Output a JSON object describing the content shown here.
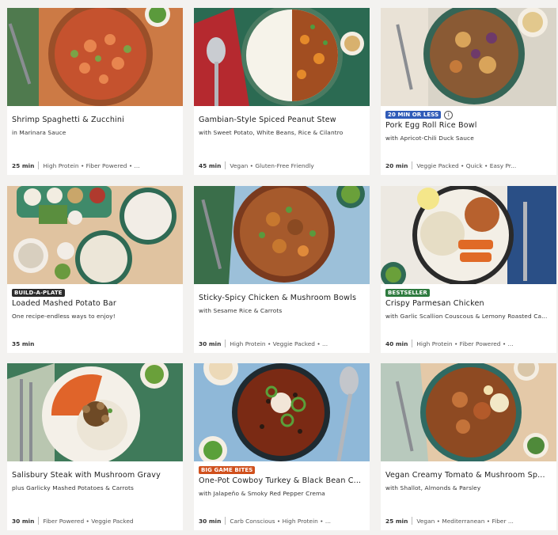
{
  "colors": {
    "badge_blue": "#2f5bb8",
    "badge_dark": "#2b2b2b",
    "badge_green": "#2d7a3e",
    "badge_orange": "#d0501c"
  },
  "cards": [
    {
      "badge": "",
      "title": "Shrimp Spaghetti & Zucchini",
      "subtitle": "in Marinara Sauce",
      "time": "25 min",
      "tags": "High Protein • Fiber Powered • ..."
    },
    {
      "badge": "",
      "title": "Gambian-Style Spiced Peanut Stew",
      "subtitle": "with Sweet Potato, White Beans, Rice & Cilantro",
      "time": "45 min",
      "tags": "Vegan • Gluten-Free Friendly"
    },
    {
      "badge": "20 MIN OR LESS",
      "title": "Pork Egg Roll Rice Bowl",
      "subtitle": "with Apricot-Chili Duck Sauce",
      "time": "20 min",
      "tags": "Veggie Packed • Quick • Easy Pr..."
    },
    {
      "badge": "BUILD-A-PLATE",
      "title": "Loaded Mashed Potato Bar",
      "subtitle": "One recipe-endless ways to enjoy!",
      "time": "35 min",
      "tags": ""
    },
    {
      "badge": "",
      "title": "Sticky-Spicy Chicken & Mushroom Bowls",
      "subtitle": "with Sesame Rice & Carrots",
      "time": "30 min",
      "tags": "High Protein • Veggie Packed • ..."
    },
    {
      "badge": "BESTSELLER",
      "title": "Crispy Parmesan Chicken",
      "subtitle": "with Garlic Scallion Couscous & Lemony Roasted Ca...",
      "time": "40 min",
      "tags": "High Protein • Fiber Powered • ..."
    },
    {
      "badge": "",
      "title": "Salisbury Steak with Mushroom Gravy",
      "subtitle": "plus Garlicky Mashed Potatoes & Carrots",
      "time": "30 min",
      "tags": "Fiber Powered • Veggie Packed"
    },
    {
      "badge": "BIG GAME BITES",
      "title": "One-Pot Cowboy Turkey & Black Bean C...",
      "subtitle": "with Jalapeño & Smoky Red Pepper Crema",
      "time": "30 min",
      "tags": "Carb Conscious • High Protein • ..."
    },
    {
      "badge": "",
      "title": "Vegan Creamy Tomato & Mushroom Sp...",
      "subtitle": "with Shallot, Almonds & Parsley",
      "time": "25 min",
      "tags": "Vegan • Mediterranean • Fiber ..."
    }
  ],
  "info_icon": "info-icon"
}
